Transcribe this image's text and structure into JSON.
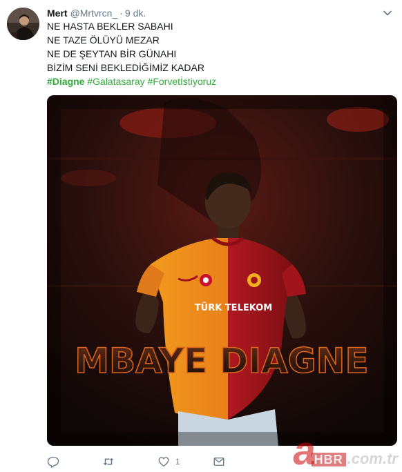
{
  "author": {
    "name": "Mert",
    "handle": "@Mrtvrcn_",
    "separator": "·",
    "time": "9 dk."
  },
  "tweet": {
    "lines": [
      "NE HASTA BEKLER SABAHI",
      "NE TAZE ÖLÜYÜ MEZAR",
      "NE DE ŞEYTAN BİR GÜNAHI",
      "BİZİM SENİ BEKLEDİĞİMİZ KADAR"
    ],
    "hashtags": {
      "first": "#Diagne",
      "second": "#Galatasaray",
      "third": "#Forvetİstiyoruz"
    },
    "hashtag_color": "#2fad3a"
  },
  "media": {
    "title_text": "MBAYE DIAGNE",
    "jersey_text": "TÜRK TELEKOM"
  },
  "actions": {
    "reply_count": "",
    "retweet_count": "",
    "like_count": "1",
    "dm_count": ""
  },
  "icons": {
    "caret": "chevron-down-icon",
    "reply": "reply-icon",
    "retweet": "retweet-icon",
    "like": "heart-icon",
    "dm": "envelope-icon"
  },
  "watermark": {
    "brand": "a",
    "sub": "HBR",
    "domain": ".com.tr"
  }
}
